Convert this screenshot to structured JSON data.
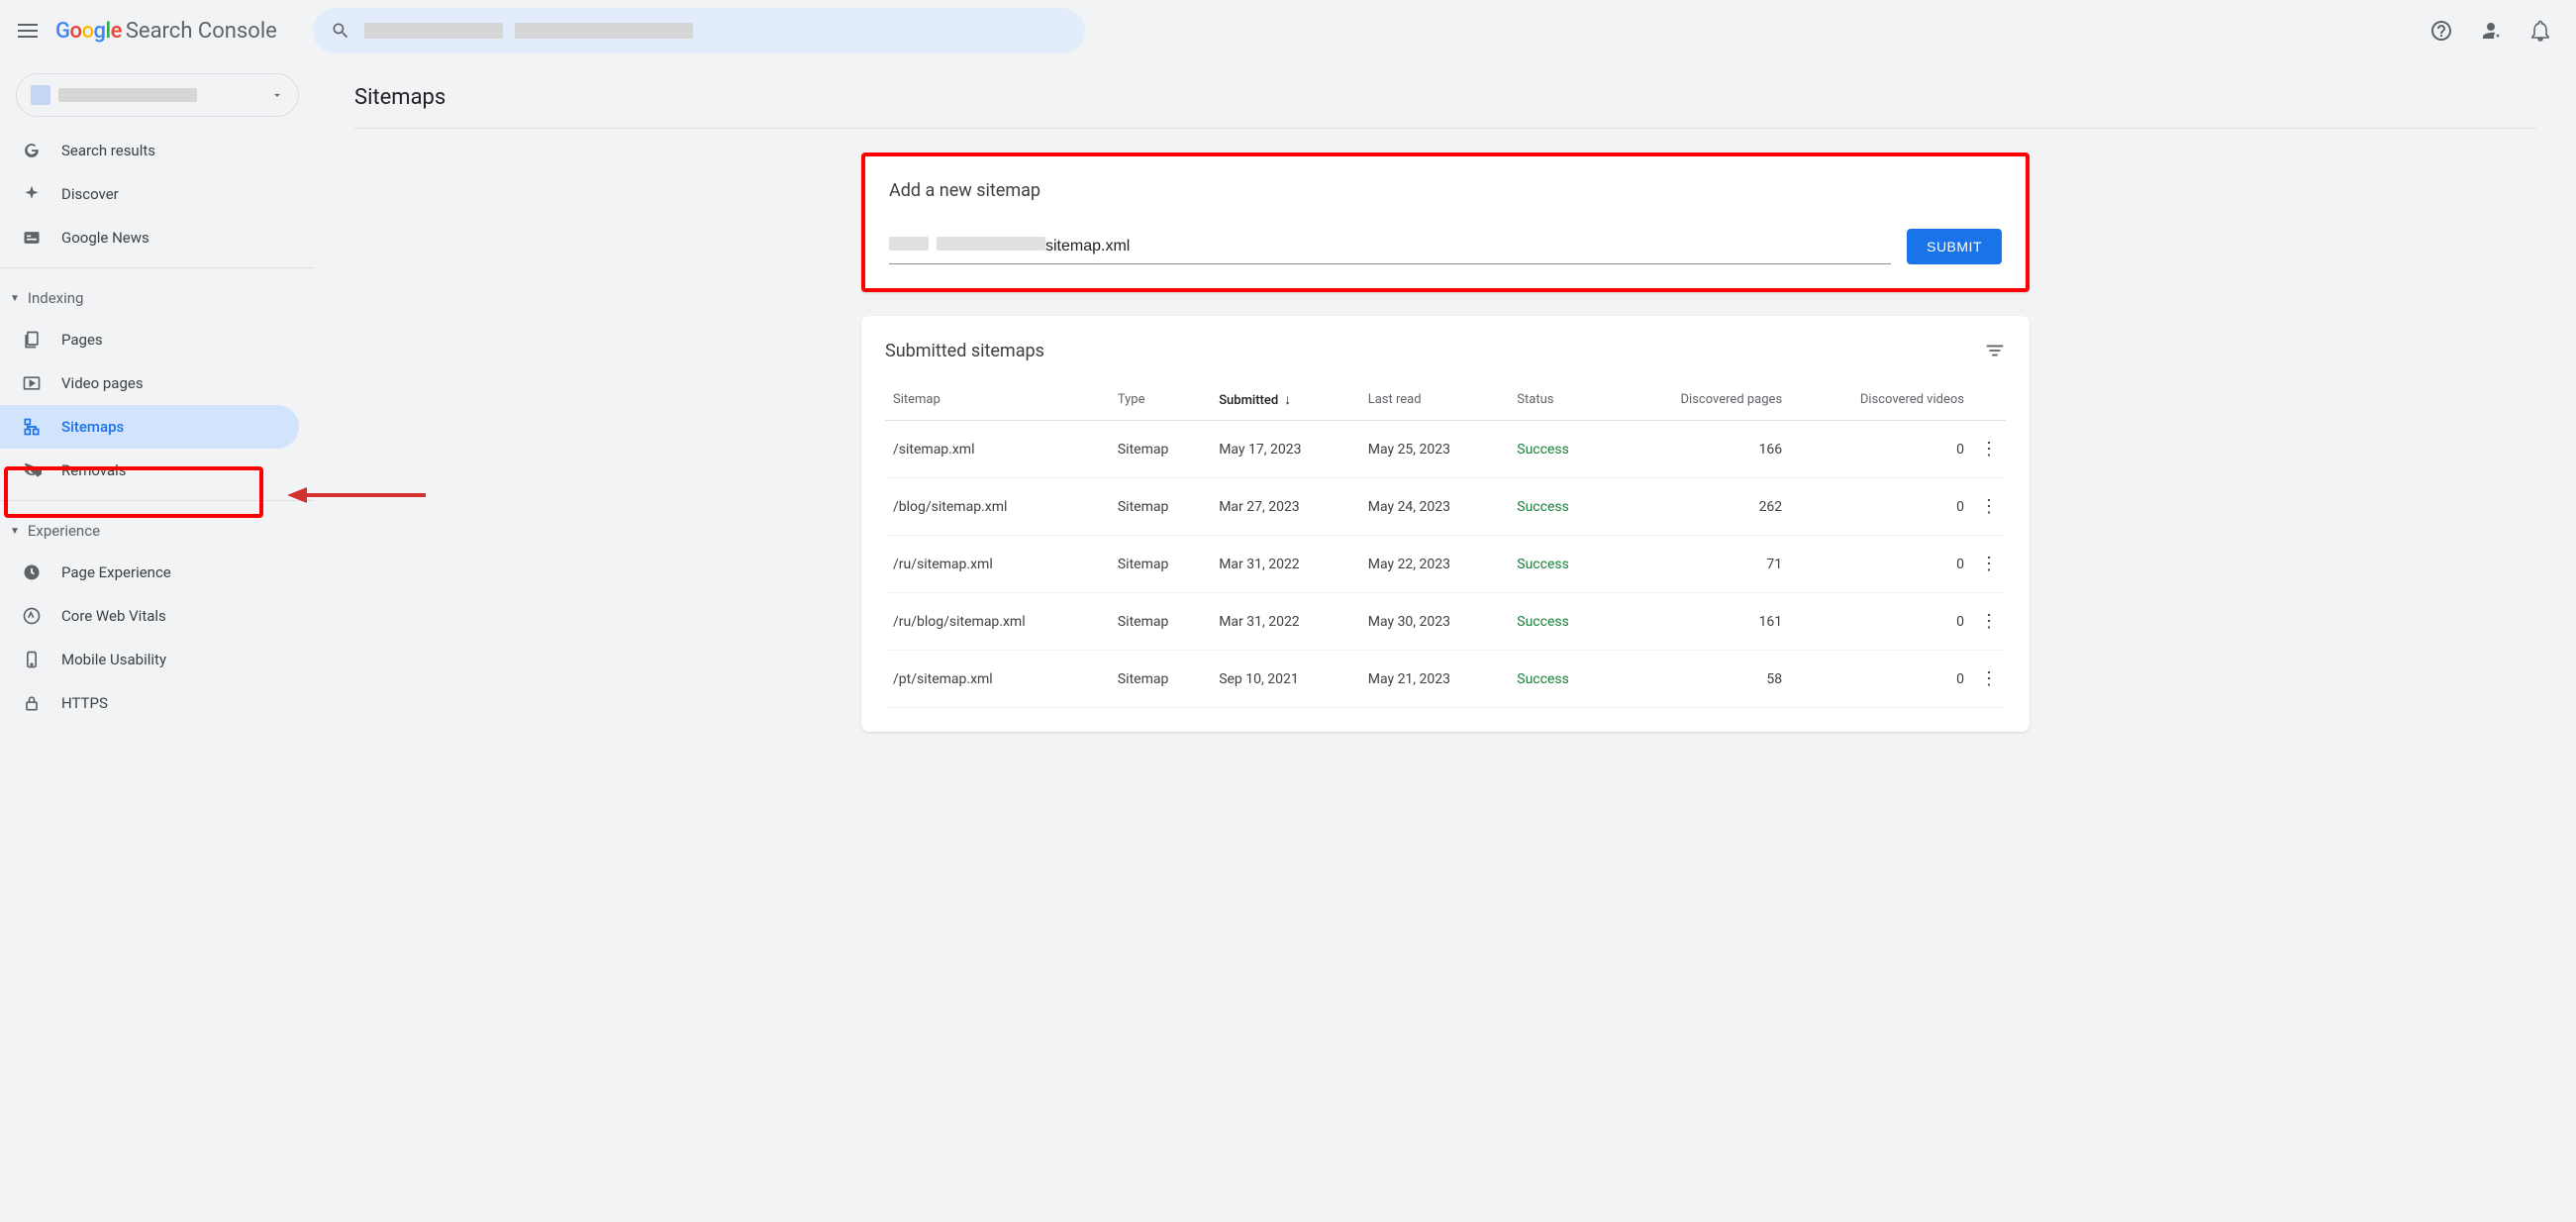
{
  "header": {
    "brand": "Google",
    "product": "Search Console"
  },
  "sidebar": {
    "items": [
      {
        "label": "Search results"
      },
      {
        "label": "Discover"
      },
      {
        "label": "Google News"
      }
    ],
    "section_indexing": "Indexing",
    "indexing_items": [
      {
        "label": "Pages"
      },
      {
        "label": "Video pages"
      },
      {
        "label": "Sitemaps"
      },
      {
        "label": "Removals"
      }
    ],
    "section_experience": "Experience",
    "experience_items": [
      {
        "label": "Page Experience"
      },
      {
        "label": "Core Web Vitals"
      },
      {
        "label": "Mobile Usability"
      },
      {
        "label": "HTTPS"
      }
    ]
  },
  "page": {
    "title": "Sitemaps",
    "add_card": {
      "title": "Add a new sitemap",
      "input_value": "sitemap.xml",
      "submit": "SUBMIT"
    },
    "list_card": {
      "title": "Submitted sitemaps",
      "columns": {
        "sitemap": "Sitemap",
        "type": "Type",
        "submitted": "Submitted",
        "last_read": "Last read",
        "status": "Status",
        "pages": "Discovered pages",
        "videos": "Discovered videos"
      },
      "rows": [
        {
          "sitemap": "/sitemap.xml",
          "type": "Sitemap",
          "submitted": "May 17, 2023",
          "last_read": "May 25, 2023",
          "status": "Success",
          "pages": "166",
          "videos": "0"
        },
        {
          "sitemap": "/blog/sitemap.xml",
          "type": "Sitemap",
          "submitted": "Mar 27, 2023",
          "last_read": "May 24, 2023",
          "status": "Success",
          "pages": "262",
          "videos": "0"
        },
        {
          "sitemap": "/ru/sitemap.xml",
          "type": "Sitemap",
          "submitted": "Mar 31, 2022",
          "last_read": "May 22, 2023",
          "status": "Success",
          "pages": "71",
          "videos": "0"
        },
        {
          "sitemap": "/ru/blog/sitemap.xml",
          "type": "Sitemap",
          "submitted": "Mar 31, 2022",
          "last_read": "May 30, 2023",
          "status": "Success",
          "pages": "161",
          "videos": "0"
        },
        {
          "sitemap": "/pt/sitemap.xml",
          "type": "Sitemap",
          "submitted": "Sep 10, 2021",
          "last_read": "May 21, 2023",
          "status": "Success",
          "pages": "58",
          "videos": "0"
        }
      ]
    }
  }
}
